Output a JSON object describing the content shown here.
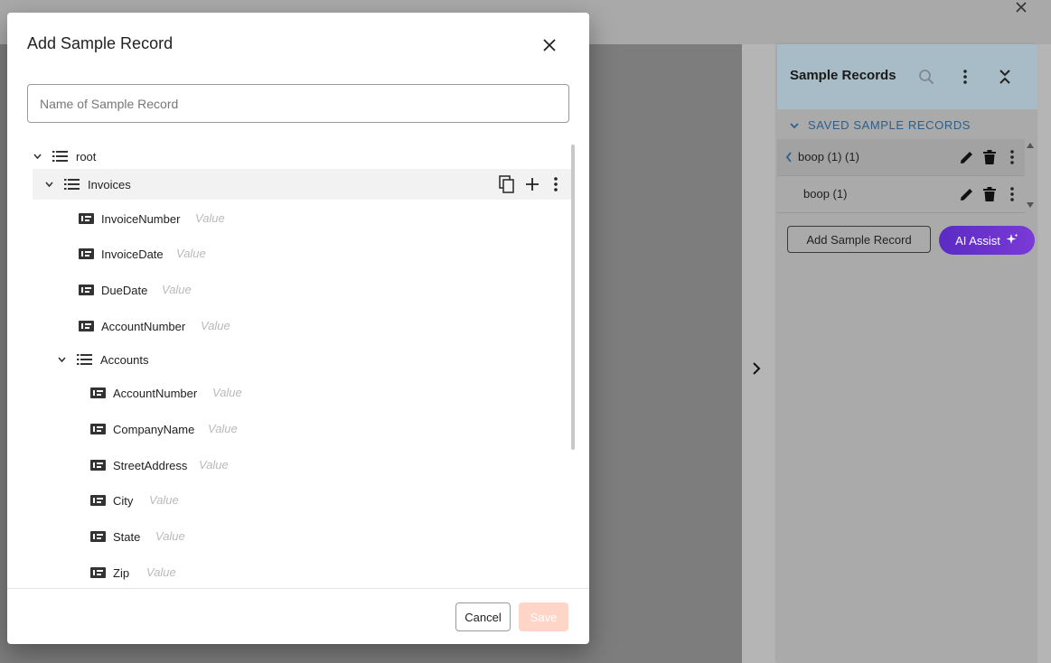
{
  "modal": {
    "title": "Add Sample Record",
    "name_placeholder": "Name of Sample Record",
    "name_value": "",
    "cancel_label": "Cancel",
    "save_label": "Save"
  },
  "tree": {
    "value_placeholder": "Value",
    "root_label": "root",
    "invoices_label": "Invoices",
    "invoice_fields": [
      "InvoiceNumber",
      "InvoiceDate",
      "DueDate",
      "AccountNumber"
    ],
    "accounts_label": "Accounts",
    "account_fields": [
      "AccountNumber",
      "CompanyName",
      "StreetAddress",
      "City",
      "State",
      "Zip"
    ]
  },
  "panel": {
    "title": "Sample Records",
    "saved_heading": "SAVED SAMPLE RECORDS",
    "records": [
      "boop (1) (1)",
      "boop (1)"
    ],
    "add_button": "Add Sample Record",
    "ai_button": "AI Assist"
  },
  "icons": {
    "close": "close-icon",
    "search": "search-icon",
    "more": "more-vert-icon",
    "collapse": "collapse-icon",
    "edit": "pencil-icon",
    "delete": "trash-icon",
    "list": "list-icon",
    "field": "field-icon",
    "copy": "copy-icon",
    "add": "plus-icon"
  },
  "colors": {
    "accent_blue": "#2d5f8a",
    "ai_purple": "#5b2bc4",
    "save_disabled": "#ffd5c8",
    "panel_header": "#a7bcc6"
  }
}
